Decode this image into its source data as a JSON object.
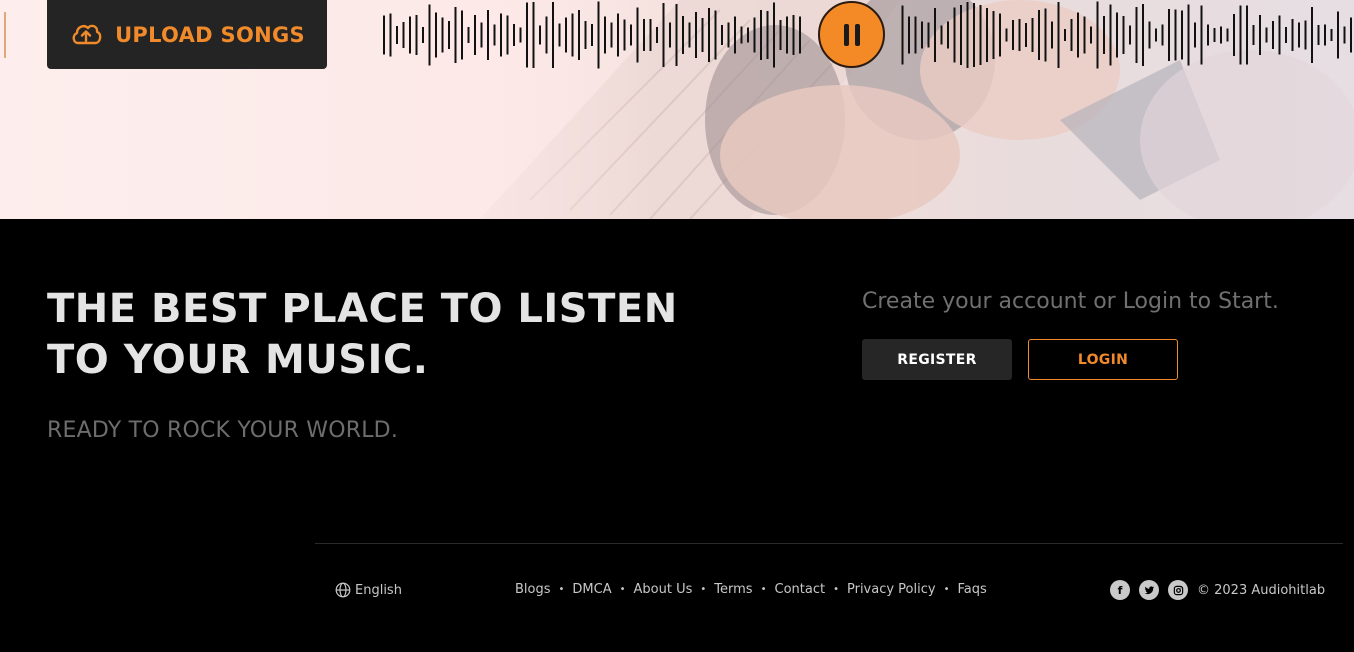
{
  "hero": {
    "upload_label": "UPLOAD SONGS",
    "accent_color": "#f08a2a",
    "player_state": "playing",
    "player_icon": "pause-icon"
  },
  "promo": {
    "headline_line1": "THE BEST PLACE TO LISTEN",
    "headline_line2": "TO YOUR MUSIC.",
    "tagline": "READY TO ROCK YOUR WORLD.",
    "cta_text": "Create your account or Login to Start.",
    "register_label": "REGISTER",
    "login_label": "LOGIN"
  },
  "footer": {
    "language": "English",
    "links": [
      "Blogs",
      "DMCA",
      "About Us",
      "Terms",
      "Contact",
      "Privacy Policy",
      "Faqs"
    ],
    "social": [
      "facebook-icon",
      "twitter-icon",
      "instagram-icon"
    ],
    "copyright": "© 2023 Audiohitlab"
  }
}
